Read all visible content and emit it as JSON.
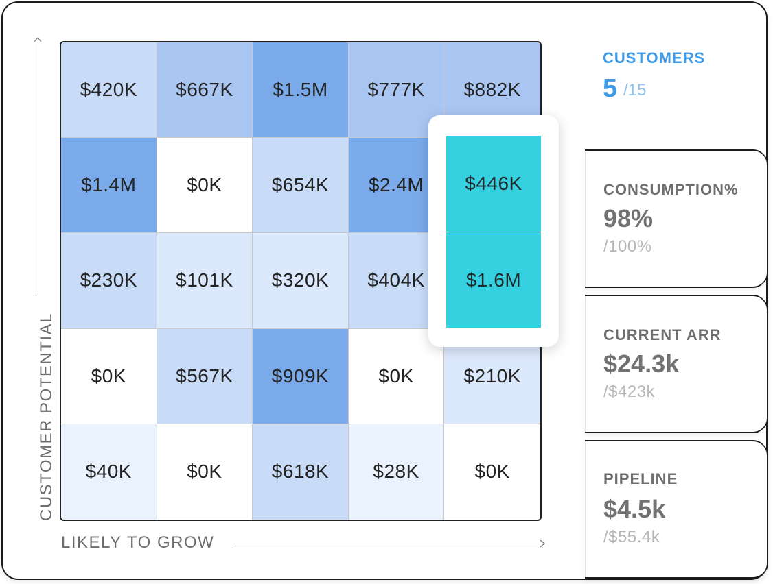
{
  "chart_data": {
    "type": "heatmap",
    "xlabel": "LIKELY TO GROW",
    "ylabel": "CUSTOMER POTENTIAL",
    "rows": [
      [
        "$420K",
        "$667K",
        "$1.5M",
        "$777K",
        "$882K"
      ],
      [
        "$1.4M",
        "$0K",
        "$654K",
        "$2.4M",
        "$446K"
      ],
      [
        "$230K",
        "$101K",
        "$320K",
        "$404K",
        "$1.6M"
      ],
      [
        "$0K",
        "$567K",
        "$909K",
        "$0K",
        "$210K"
      ],
      [
        "$40K",
        "$0K",
        "$618K",
        "$28K",
        "$0K"
      ]
    ],
    "cell_colors": [
      [
        "#c8dcf8",
        "#a9c6f3",
        "#7aaaea",
        "#a9c6f3",
        "#a9c6f3"
      ],
      [
        "#7aaaea",
        "#ffffff",
        "#c8dcf8",
        "#7aaaea",
        "#36d1e0"
      ],
      [
        "#c8dcf8",
        "#dce8fb",
        "#dce8fb",
        "#c8dcf8",
        "#36d1e0"
      ],
      [
        "#ffffff",
        "#c8dcf8",
        "#7aaaea",
        "#ffffff",
        "#dce8fb"
      ],
      [
        "#eaf2fd",
        "#ffffff",
        "#c8dcf8",
        "#eaf2fd",
        "#ffffff"
      ]
    ],
    "highlight_color": "#36d1e0",
    "highlighted_column": 4,
    "highlighted_rows": [
      1,
      2
    ]
  },
  "stats": {
    "customers": {
      "title": "CUSTOMERS",
      "value": "5",
      "sub": "/15",
      "color": "#3d9bea"
    },
    "consumption": {
      "title": "CONSUMPTION%",
      "value": "98%",
      "sub": "/100%"
    },
    "current_arr": {
      "title": "CURRENT ARR",
      "value": "$24.3k",
      "sub": "/$423k"
    },
    "pipeline": {
      "title": "PIPELINE",
      "value": "$4.5k",
      "sub": "/$55.4k"
    }
  }
}
